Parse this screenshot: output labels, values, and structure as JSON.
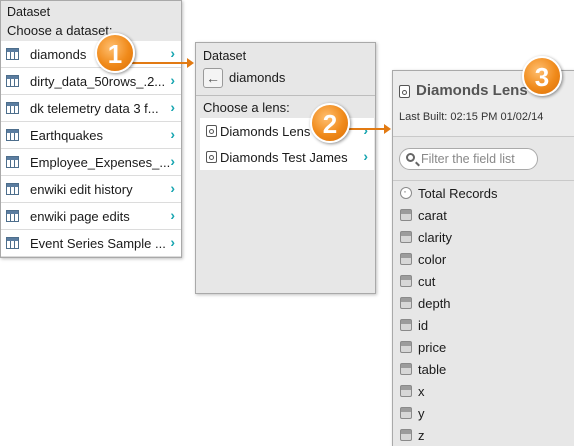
{
  "dataset_panel": {
    "title": "Dataset",
    "subtitle": "Choose a dataset:",
    "items": [
      {
        "label": "diamonds"
      },
      {
        "label": "dirty_data_50rows_.2..."
      },
      {
        "label": "dk telemetry data 3 f..."
      },
      {
        "label": "Earthquakes"
      },
      {
        "label": "Employee_Expenses_..."
      },
      {
        "label": "enwiki edit history"
      },
      {
        "label": "enwiki page edits"
      },
      {
        "label": "Event Series Sample ..."
      }
    ]
  },
  "lens_panel": {
    "title": "Dataset",
    "dataset_name": "diamonds",
    "subtitle": "Choose a lens:",
    "lenses": [
      {
        "label": "Diamonds Lens"
      },
      {
        "label": "Diamonds Test James"
      }
    ]
  },
  "field_panel": {
    "title": "Diamonds Lens",
    "last_built": "Last Built: 02:15 PM 01/02/14",
    "search_placeholder": "Filter the field list",
    "fields": [
      {
        "label": "Total Records"
      },
      {
        "label": "carat"
      },
      {
        "label": "clarity"
      },
      {
        "label": "color"
      },
      {
        "label": "cut"
      },
      {
        "label": "depth"
      },
      {
        "label": "id"
      },
      {
        "label": "price"
      },
      {
        "label": "table"
      },
      {
        "label": "x"
      },
      {
        "label": "y"
      },
      {
        "label": "z"
      }
    ]
  },
  "steps": [
    "1",
    "2",
    "3"
  ],
  "colors": {
    "accent": "#f08a1a",
    "chevron": "#17a5b0",
    "panel_bg": "#e7e7e7"
  }
}
